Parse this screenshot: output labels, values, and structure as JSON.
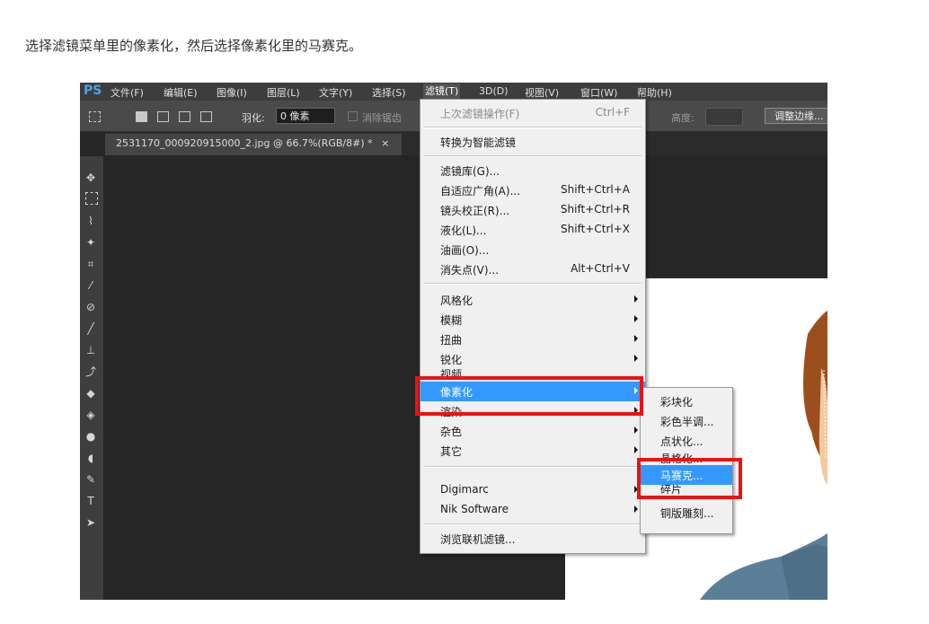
{
  "caption": "选择滤镜菜单里的像素化，然后选择像素化里的马赛克。",
  "menubar": {
    "logo": "PS",
    "items": [
      "文件(F)",
      "编辑(E)",
      "图像(I)",
      "图层(L)",
      "文字(Y)",
      "选择(S)",
      "滤镜(T)",
      "3D(D)",
      "视图(V)",
      "窗口(W)",
      "帮助(H)"
    ],
    "active_index": 6
  },
  "options_bar": {
    "feather_label": "羽化:",
    "feather_value": "0 像素",
    "antialias_label": "消除锯齿",
    "height_label": "高度:",
    "refine_edge_button": "调整边缘..."
  },
  "document_tab": {
    "label": "2531170_000920915000_2.jpg @ 66.7%(RGB/8#) *",
    "close": "×"
  },
  "filter_menu": {
    "items": [
      {
        "label": "上次滤镜操作(F)",
        "shortcut": "Ctrl+F",
        "disabled": true
      },
      {
        "label": "转换为智能滤镜"
      },
      {
        "label": "滤镜库(G)..."
      },
      {
        "label": "自适应广角(A)...",
        "shortcut": "Shift+Ctrl+A"
      },
      {
        "label": "镜头校正(R)...",
        "shortcut": "Shift+Ctrl+R"
      },
      {
        "label": "液化(L)...",
        "shortcut": "Shift+Ctrl+X"
      },
      {
        "label": "油画(O)..."
      },
      {
        "label": "消失点(V)...",
        "shortcut": "Alt+Ctrl+V"
      },
      {
        "label": "风格化",
        "submenu": true
      },
      {
        "label": "模糊",
        "submenu": true
      },
      {
        "label": "扭曲",
        "submenu": true
      },
      {
        "label": "锐化",
        "submenu": true
      },
      {
        "label": "视频",
        "submenu": true
      },
      {
        "label": "像素化",
        "submenu": true,
        "highlighted": true
      },
      {
        "label": "渲染",
        "submenu": true
      },
      {
        "label": "杂色",
        "submenu": true
      },
      {
        "label": "其它",
        "submenu": true
      },
      {
        "label": "Digimarc",
        "submenu": true
      },
      {
        "label": "Nik Software",
        "submenu": true
      },
      {
        "label": "浏览联机滤镜..."
      }
    ]
  },
  "pixelate_submenu": {
    "items": [
      {
        "label": "彩块化"
      },
      {
        "label": "彩色半调..."
      },
      {
        "label": "点状化..."
      },
      {
        "label": "晶格化..."
      },
      {
        "label": "马赛克...",
        "highlighted": true
      },
      {
        "label": "碎片"
      },
      {
        "label": "铜版雕刻..."
      }
    ]
  },
  "colors": {
    "highlight": "#3399ff",
    "annotation_red": "#ee1111",
    "ps_dark": "#262626"
  }
}
